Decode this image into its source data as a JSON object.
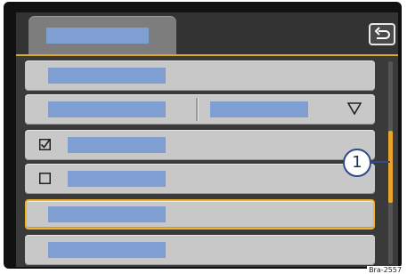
{
  "header": {
    "tab_label": "",
    "back_icon": "back-arrow-icon"
  },
  "list": {
    "items": [
      {
        "label": "",
        "type": "plain"
      },
      {
        "label": "",
        "type": "dropdown",
        "value": "",
        "icon": "triangle-down-icon"
      },
      {
        "label": "",
        "type": "checkbox",
        "checked": true
      },
      {
        "label": "",
        "type": "checkbox",
        "checked": false
      },
      {
        "label": "",
        "type": "plain",
        "selected": true
      },
      {
        "label": "",
        "type": "plain"
      }
    ],
    "scroll_position": 0.5
  },
  "callout": {
    "number": "1"
  },
  "image_code": "Bra-2557",
  "colors": {
    "accent": "#f0b42a",
    "placeholder": "#7f9ed2",
    "item_bg": "#c8c8c8",
    "callout_stroke": "#2f4a8a"
  }
}
